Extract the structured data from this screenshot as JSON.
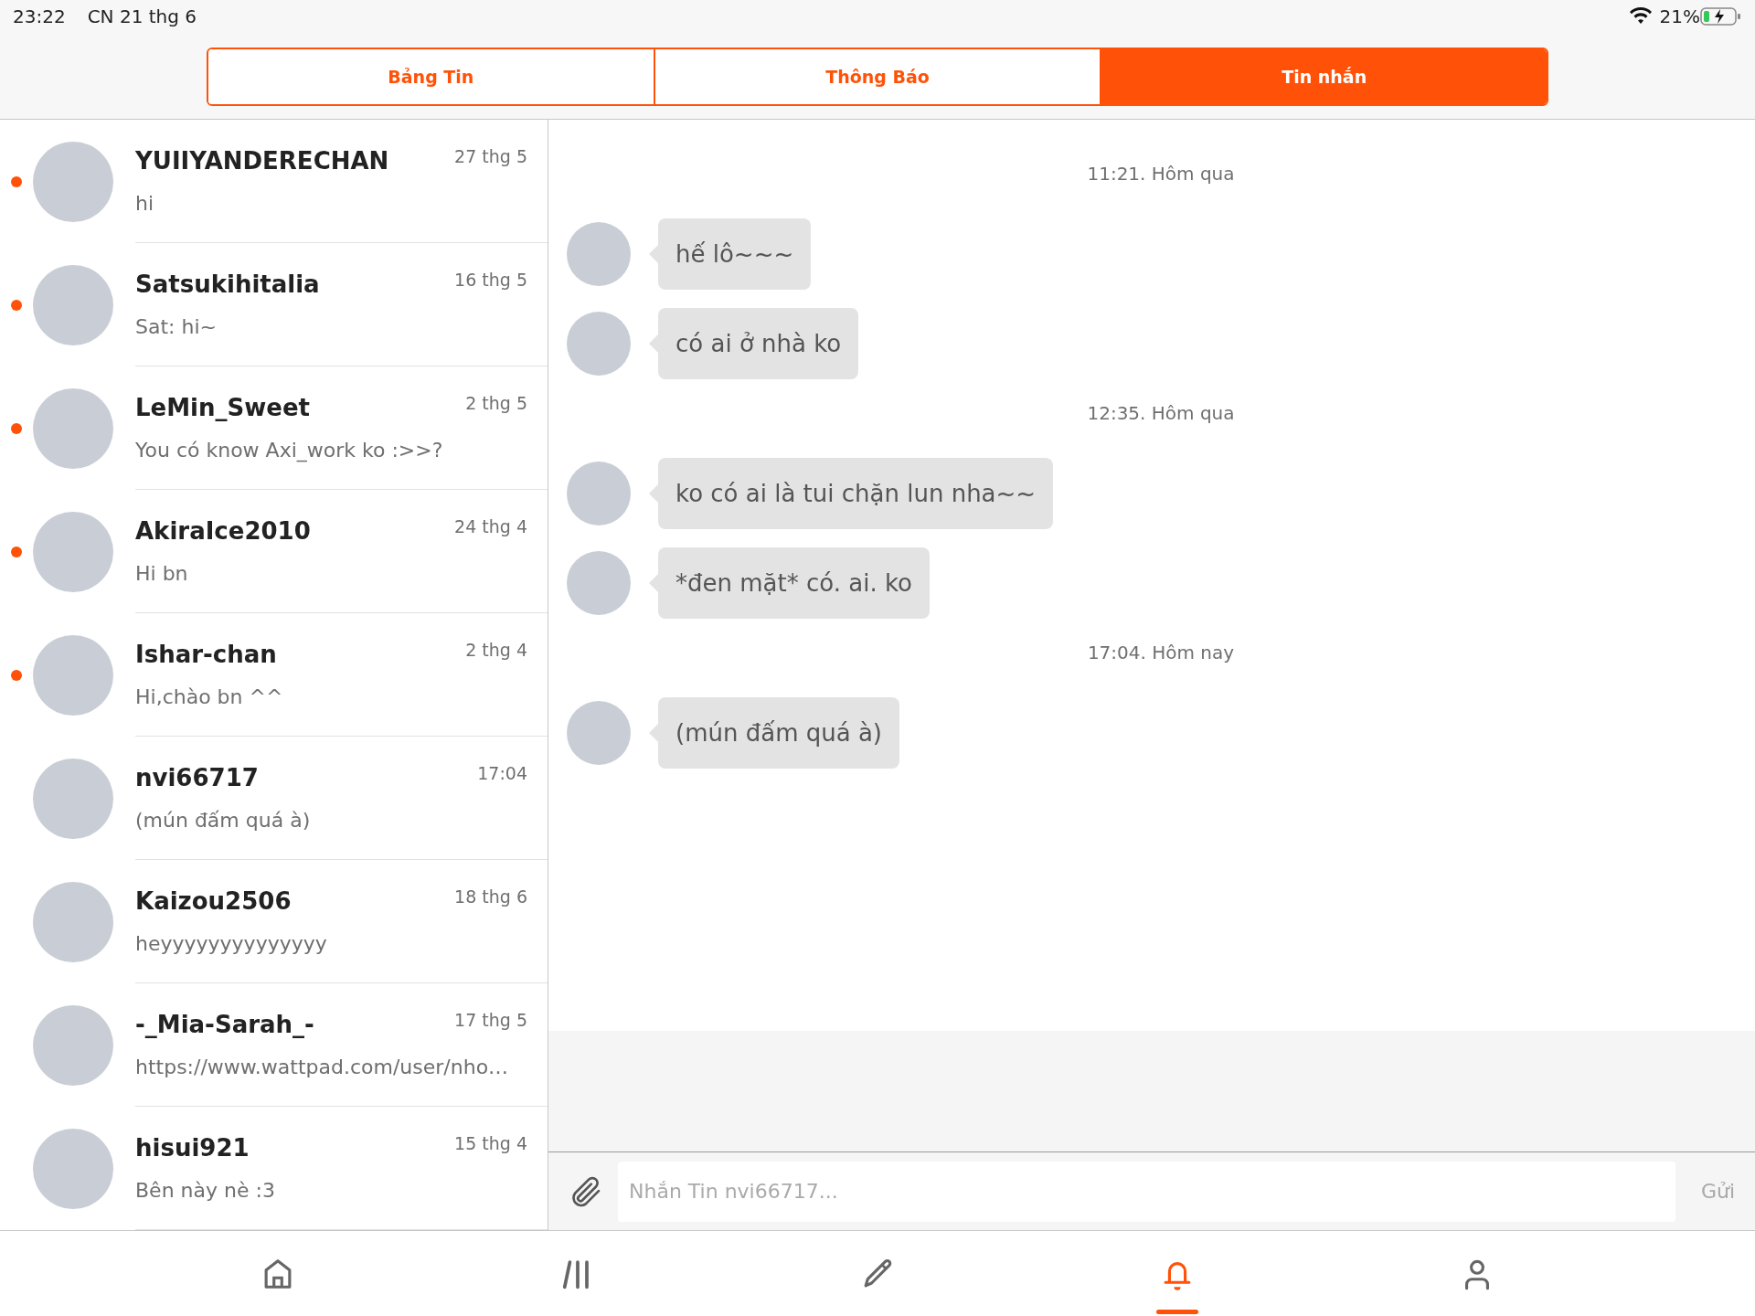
{
  "status_bar": {
    "time": "23:22",
    "date": "CN 21 thg 6",
    "battery": "21%"
  },
  "tabs": [
    {
      "label": "Bảng Tin",
      "selected": false
    },
    {
      "label": "Thông Báo",
      "selected": false
    },
    {
      "label": "Tin nhắn",
      "selected": true
    }
  ],
  "conversations": [
    {
      "name": "YUIIYANDERECHAN",
      "date": "27 thg 5",
      "preview": "hi",
      "unread": true,
      "selected": false
    },
    {
      "name": "Satsukihitalia",
      "date": "16 thg 5",
      "preview": "Sat: hi~",
      "unread": true,
      "selected": false
    },
    {
      "name": "LeMin_Sweet",
      "date": "2 thg 5",
      "preview": "You có know Axi_work ko :>>?",
      "unread": true,
      "selected": false
    },
    {
      "name": "AkiraIce2010",
      "date": "24 thg 4",
      "preview": "Hi bn",
      "unread": true,
      "selected": false
    },
    {
      "name": "Ishar-chan",
      "date": "2 thg 4",
      "preview": "Hi,chào bn ^^",
      "unread": true,
      "selected": false
    },
    {
      "name": "nvi66717",
      "date": "17:04",
      "preview": "(mún đấm quá à)",
      "unread": false,
      "selected": false
    },
    {
      "name": "Kaizou2506",
      "date": "18 thg 6",
      "preview": "heyyyyyyyyyyyyyy",
      "unread": false,
      "selected": false
    },
    {
      "name": "-_Mia-Sarah_-",
      "date": "17 thg 5",
      "preview": "https://www.wattpad.com/user/nho…",
      "unread": false,
      "selected": false
    },
    {
      "name": "hisui921",
      "date": "15 thg 4",
      "preview": "Bên này nè :3",
      "unread": false,
      "selected": false
    }
  ],
  "chat": {
    "messages": [
      {
        "kind": "timestamp",
        "text": "11:21. Hôm qua"
      },
      {
        "kind": "message",
        "text": "hế lô~~~"
      },
      {
        "kind": "message",
        "text": "có ai ở nhà ko"
      },
      {
        "kind": "timestamp",
        "text": "12:35. Hôm qua"
      },
      {
        "kind": "message",
        "text": "ko có ai là tui chặn lun nha~~"
      },
      {
        "kind": "message",
        "text": "*đen mặt* có. ai. ko"
      },
      {
        "kind": "timestamp",
        "text": "17:04. Hôm nay"
      },
      {
        "kind": "message",
        "text": "(mún đấm quá à)"
      }
    ],
    "input": {
      "placeholder": "Nhắn Tin nvi66717..."
    },
    "send_button": {
      "label": "Gửi",
      "disabled": true
    }
  },
  "bottom_nav": [
    {
      "kind": "home",
      "selected": false
    },
    {
      "kind": "library",
      "selected": false
    },
    {
      "kind": "write",
      "selected": false
    },
    {
      "kind": "notifications",
      "selected": true
    },
    {
      "kind": "profile",
      "selected": false
    }
  ]
}
